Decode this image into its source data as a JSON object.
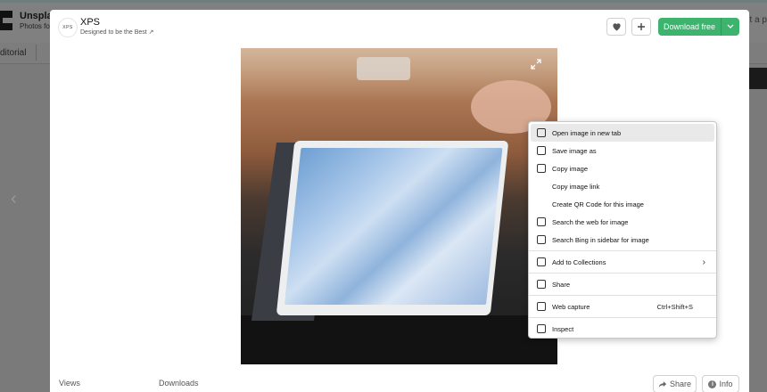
{
  "background": {
    "title": "Unsplas",
    "subtitle": "Photos fo",
    "right_text": "it a p",
    "tab": "ditorial"
  },
  "modal": {
    "author": {
      "avatar_text": "XPS",
      "name": "XPS",
      "bio": "Designed to be the Best ↗"
    },
    "actions": {
      "like_icon": "heart-icon",
      "add_icon": "plus-icon",
      "download_label": "Download free",
      "download_caret": "chevron-down-icon"
    },
    "stats": {
      "views_label": "Views",
      "downloads_label": "Downloads"
    },
    "footer": {
      "share_label": "Share",
      "info_label": "Info"
    }
  },
  "context_menu": {
    "items": [
      {
        "label": "Open image in new tab",
        "icon": "new-tab-icon"
      },
      {
        "label": "Save image as",
        "icon": "save-image-icon"
      },
      {
        "label": "Copy image",
        "icon": "copy-image-icon"
      },
      {
        "label": "Copy image link",
        "icon": ""
      },
      {
        "label": "Create QR Code for this image",
        "icon": ""
      },
      {
        "label": "Search the web for image",
        "icon": "image-search-icon"
      },
      {
        "label": "Search Bing in sidebar for image",
        "icon": "bing-sidebar-icon"
      },
      {
        "label": "Add to Collections",
        "icon": "collections-icon"
      },
      {
        "label": "Share",
        "icon": "share-icon"
      },
      {
        "label": "Web capture",
        "icon": "web-capture-icon",
        "shortcut": "Ctrl+Shift+S"
      },
      {
        "label": "Inspect",
        "icon": "inspect-icon"
      }
    ]
  }
}
